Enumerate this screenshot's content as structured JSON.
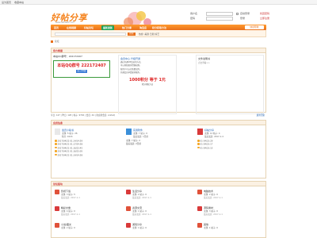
{
  "topbar": {
    "left_links": [
      "设为首页",
      "收藏本站"
    ]
  },
  "header": {
    "logo_text": "好帖分享",
    "logo_sub": "www.haotiefx.com",
    "login": {
      "username_label": "用户名",
      "password_label": "密码",
      "auto_login": "自动登录",
      "find_password": "找回密码",
      "register": "立即注册",
      "login_button": "登录"
    }
  },
  "nav": {
    "items": [
      "首页",
      "在线视频",
      "好帖论坛",
      "最新更新",
      "热门分享",
      "淘宝店",
      "积分获取方法"
    ],
    "active_index": 3,
    "right_button": "快捷导航"
  },
  "subnav": {
    "search_button": "搜索",
    "hot_search": "热搜: 美剧 日剧 综艺"
  },
  "breadcrumb": "论坛",
  "ad_panel": {
    "title": "官方客服",
    "box1_title": "本站QQ群号：222172407",
    "box1_qq": "本站QQ群号 222172407",
    "box1_btn": "加入QQ群",
    "box2_title": "会员中心 升级开通",
    "box2_lines": [
      "会员中心 升级开通",
      "通过开通VIP会员的方式，",
      "可以获取更多资源权限。",
      "新用户可以先免费试用，",
      "开通会员享受更多服务。"
    ],
    "box2_promo": "1000积分 等于 1元",
    "box2_note": "积分获取方法",
    "box3_title": "文件说明书",
    "box3_sub": "点击查看>>"
  },
  "statbar": {
    "text": "今日: 147  |  昨日: 128  |  帖子: 9702  |  会员: 44  |  欢迎新会员: AnitaQ",
    "right_link": "最新回复"
  },
  "info_panel": {
    "title": "会员信息",
    "columns": [
      {
        "name": "会员小秘书",
        "meta": "主题: 5  帖子: 26",
        "meta2": "积分: 1024",
        "list": [
          "2017/04/22 01:14/14:59",
          "2017/04/21 01:17/24:58",
          "2017/04/21 01:16/23:45",
          "2017/04/21 01:16/23:05",
          "2017/04/21 01:14/14:58"
        ]
      },
      {
        "name": "实用软件",
        "meta": "主题: 7  帖子: 0",
        "meta2": "最后发表: 1天前",
        "list": [
          "主题: 7  帖子: 2",
          "最后发表: 2天前"
        ]
      },
      {
        "name": "好帖分享",
        "meta": "主题: 12  帖子: 4",
        "meta2": "最后发表: 2017-1-4",
        "list": [
          "01-04/23:29",
          "01-04/23:17",
          "01-04/23:15"
        ]
      }
    ]
  },
  "forum_panel": {
    "title": "论坛版块",
    "forums": [
      {
        "title": "影视下载",
        "meta": "主题: 3  帖子: 5",
        "last": "最后发表: 2017-1-1"
      },
      {
        "title": "生活分享",
        "meta": "主题: 2  帖子: 0",
        "last": "最后发表: 2017-1-1"
      },
      {
        "title": "电脑技术",
        "meta": "主题: 2  帖子: 0",
        "last": "最后发表: 2017-1-1"
      },
      {
        "title": "精彩文章",
        "meta": "主题: 4  帖子: 0",
        "last": "最后发表: 2017-1-1"
      },
      {
        "title": "资源交流",
        "meta": "主题: 1  帖子: 0",
        "last": "最后发表: 2017-1-1"
      },
      {
        "title": "源码素材",
        "meta": "主题: 3  帖子: 0",
        "last": "最后发表: 2017-1-1"
      },
      {
        "title": "小说/图文",
        "meta": "主题: 2  帖子: 0",
        "last": "最后发表: 2017-1-1"
      },
      {
        "title": "游戏分享",
        "meta": "主题: 1  帖子: 0",
        "last": "最后发表: 2017-1-1"
      },
      {
        "title": "其他",
        "meta": "主题: 1  帖子: 0",
        "last": "最后发表: 2017-1-1"
      }
    ]
  },
  "colors": {
    "brand_orange": "#e9701a",
    "active_green": "#1fa35a",
    "red_text": "#d22",
    "link_blue": "#1a5fb4"
  }
}
